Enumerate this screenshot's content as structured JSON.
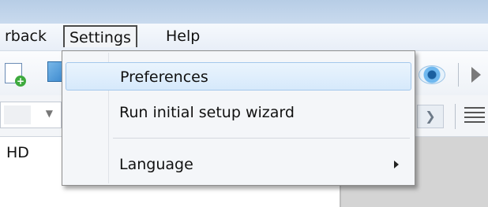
{
  "menubar": {
    "items": [
      {
        "label": "rback"
      },
      {
        "label": "Settings"
      },
      {
        "label": "Help"
      }
    ]
  },
  "settings_menu": {
    "items": [
      {
        "label": "Preferences",
        "highlighted": true
      },
      {
        "label": "Run initial setup wizard"
      },
      {
        "label": "Language",
        "has_submenu": true
      }
    ]
  },
  "content": {
    "text": "HD"
  },
  "icons": {
    "toolbar_left": [
      "new-document-icon",
      "image-icon"
    ],
    "toolbar_right": [
      "eye-icon",
      "play-icon"
    ],
    "toolbar2_right": [
      "dropdown-arrow-icon",
      "align-icon"
    ]
  },
  "colors": {
    "highlight": "#d6e9fb",
    "highlight_border": "#a4c8ec",
    "titlebar": "#b7cde6"
  }
}
